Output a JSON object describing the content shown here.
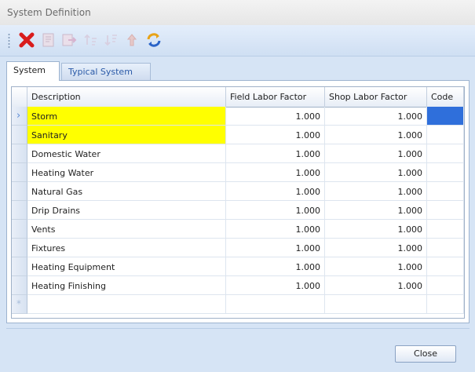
{
  "window": {
    "title": "System Definition"
  },
  "toolbar": {
    "buttons": [
      {
        "icon": "delete-icon"
      },
      {
        "icon": "edit-icon"
      },
      {
        "icon": "export-icon"
      },
      {
        "icon": "sort-ascending-icon"
      },
      {
        "icon": "sort-descending-icon"
      },
      {
        "icon": "move-up-icon"
      },
      {
        "icon": "refresh-icon"
      }
    ]
  },
  "tabs": [
    {
      "label": "System",
      "active": true
    },
    {
      "label": "Typical System",
      "active": false
    }
  ],
  "grid": {
    "columns": [
      "Description",
      "Field Labor Factor",
      "Shop Labor Factor",
      "Code"
    ],
    "rows": [
      {
        "description": "Storm",
        "field": "1.000",
        "shop": "1.000",
        "code": "",
        "highlight": true
      },
      {
        "description": "Sanitary",
        "field": "1.000",
        "shop": "1.000",
        "code": "",
        "highlight": true
      },
      {
        "description": "Domestic Water",
        "field": "1.000",
        "shop": "1.000",
        "code": ""
      },
      {
        "description": "Heating Water",
        "field": "1.000",
        "shop": "1.000",
        "code": ""
      },
      {
        "description": "Natural Gas",
        "field": "1.000",
        "shop": "1.000",
        "code": ""
      },
      {
        "description": "Drip Drains",
        "field": "1.000",
        "shop": "1.000",
        "code": ""
      },
      {
        "description": "Vents",
        "field": "1.000",
        "shop": "1.000",
        "code": ""
      },
      {
        "description": "Fixtures",
        "field": "1.000",
        "shop": "1.000",
        "code": ""
      },
      {
        "description": "Heating Equipment",
        "field": "1.000",
        "shop": "1.000",
        "code": ""
      },
      {
        "description": "Heating Finishing",
        "field": "1.000",
        "shop": "1.000",
        "code": ""
      }
    ],
    "current_row_marker": "›",
    "new_row_marker": "*"
  },
  "footer": {
    "close_label": "Close"
  },
  "colors": {
    "highlight": "#ffff00",
    "selection": "#2f6fdb",
    "tab_link": "#2b5aa8"
  }
}
